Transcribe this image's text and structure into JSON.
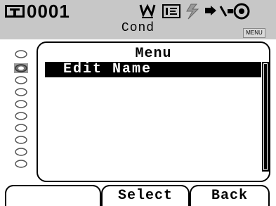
{
  "header": {
    "sample_number": "0001",
    "condition_label": "Cond",
    "menu_tag": "MENU"
  },
  "menu": {
    "title": "Menu",
    "items": [
      {
        "label": "Edit Name",
        "selected": true
      }
    ]
  },
  "softkeys": {
    "left": "",
    "center": "Select",
    "right": "Back"
  },
  "colors": {
    "header_bg": "#c7c7c7",
    "highlight_bg": "#000000",
    "highlight_fg": "#ffffff"
  },
  "icons": [
    "target-icon",
    "measure-mode-icon",
    "edit-icon",
    "power-icon",
    "connection-icon",
    "light-source-icon"
  ]
}
